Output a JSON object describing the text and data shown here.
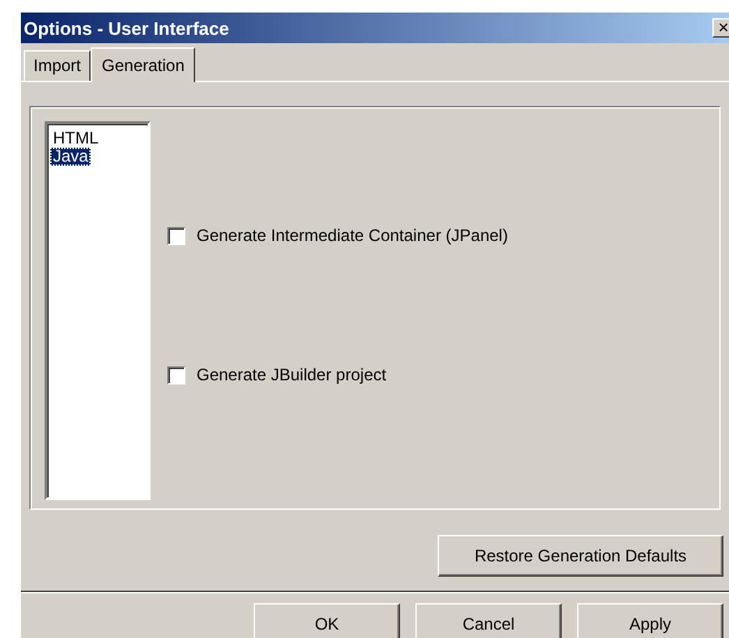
{
  "window": {
    "title": "Options - User Interface",
    "close": "×"
  },
  "tabs": [
    {
      "label": "Import",
      "selected": false
    },
    {
      "label": "Generation",
      "selected": true
    }
  ],
  "languages": [
    {
      "label": "HTML",
      "selected": false
    },
    {
      "label": "Java",
      "selected": true
    }
  ],
  "options": [
    {
      "label": "Generate Intermediate Container (JPanel)",
      "checked": false
    },
    {
      "label": "Generate JBuilder project",
      "checked": false
    }
  ],
  "restore_button": "Restore Generation Defaults",
  "buttons": [
    "OK",
    "Cancel",
    "Apply"
  ]
}
